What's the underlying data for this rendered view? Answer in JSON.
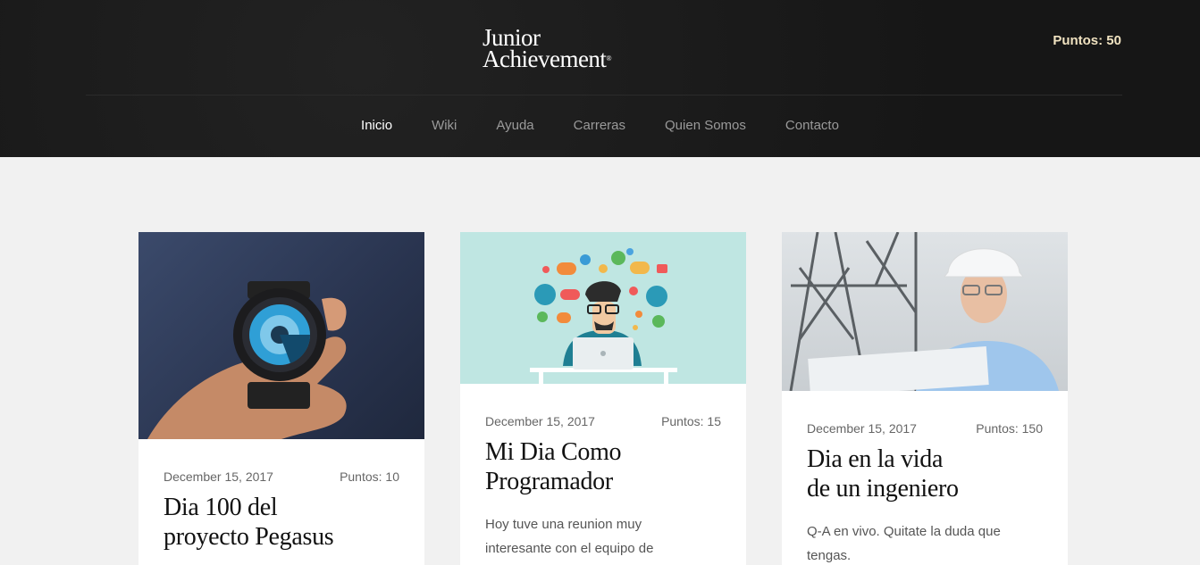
{
  "header": {
    "logo_line1": "Junior",
    "logo_line2": "Achievement",
    "logo_mark": "®",
    "points": "Puntos: 50"
  },
  "nav": [
    {
      "label": "Inicio",
      "active": true
    },
    {
      "label": "Wiki"
    },
    {
      "label": "Ayuda"
    },
    {
      "label": "Carreras"
    },
    {
      "label": "Quien Somos"
    },
    {
      "label": "Contacto"
    }
  ],
  "cards": [
    {
      "image_icon": "watch-in-hand-photo",
      "date": "December 15, 2017",
      "points": "Puntos: 10",
      "title": "Dia 100 del\nproyecto Pegasus",
      "excerpt": ""
    },
    {
      "image_icon": "programmer-illustration",
      "date": "December 15, 2017",
      "points": "Puntos: 15",
      "title": "Mi Dia Como\nProgramador",
      "excerpt": "Hoy tuve una reunion muy\ninteresante con el equipo de"
    },
    {
      "image_icon": "engineer-photo",
      "date": "December 15, 2017",
      "points": "Puntos: 150",
      "title": "Dia en la vida\nde un ingeniero",
      "excerpt": "Q-A en vivo. Quitate la duda que\ntengas."
    }
  ],
  "colors": {
    "header_bg": "#1a1a1a",
    "points_gold": "#f0e2c0",
    "page_bg": "#f1f1f1",
    "illustration_bg": "#bfe6e2"
  }
}
